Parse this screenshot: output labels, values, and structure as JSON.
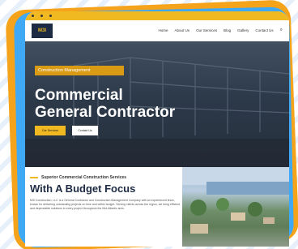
{
  "brand": {
    "logo_text": "M3I"
  },
  "topbar": {
    "left_text": "",
    "right_text": ""
  },
  "nav": {
    "items": [
      "Home",
      "About Us",
      "Our Services",
      "Blog",
      "Gallery",
      "Contact Us"
    ]
  },
  "hero": {
    "tag": "Construction Management",
    "title_line1": "Commercial",
    "title_line2": "General Contractor",
    "primary_button": "Our Services",
    "secondary_button": "Contact Us"
  },
  "section": {
    "subtitle": "Superior Commercial Construction Services",
    "heading": "With A Budget Focus",
    "body": "M3I Construction, LLC is a General Contractor and Construction Management Company with an experienced team, known for delivering outstanding projects on time and within budget. Serving clients across the region, we bring efficient and dependable solutions to every project throughout the Mid-Atlantic area."
  },
  "colors": {
    "accent": "#f0b921",
    "navy": "#1d2a44",
    "frame_blue": "#3fa9f5",
    "frame_orange": "#f5a31a"
  }
}
